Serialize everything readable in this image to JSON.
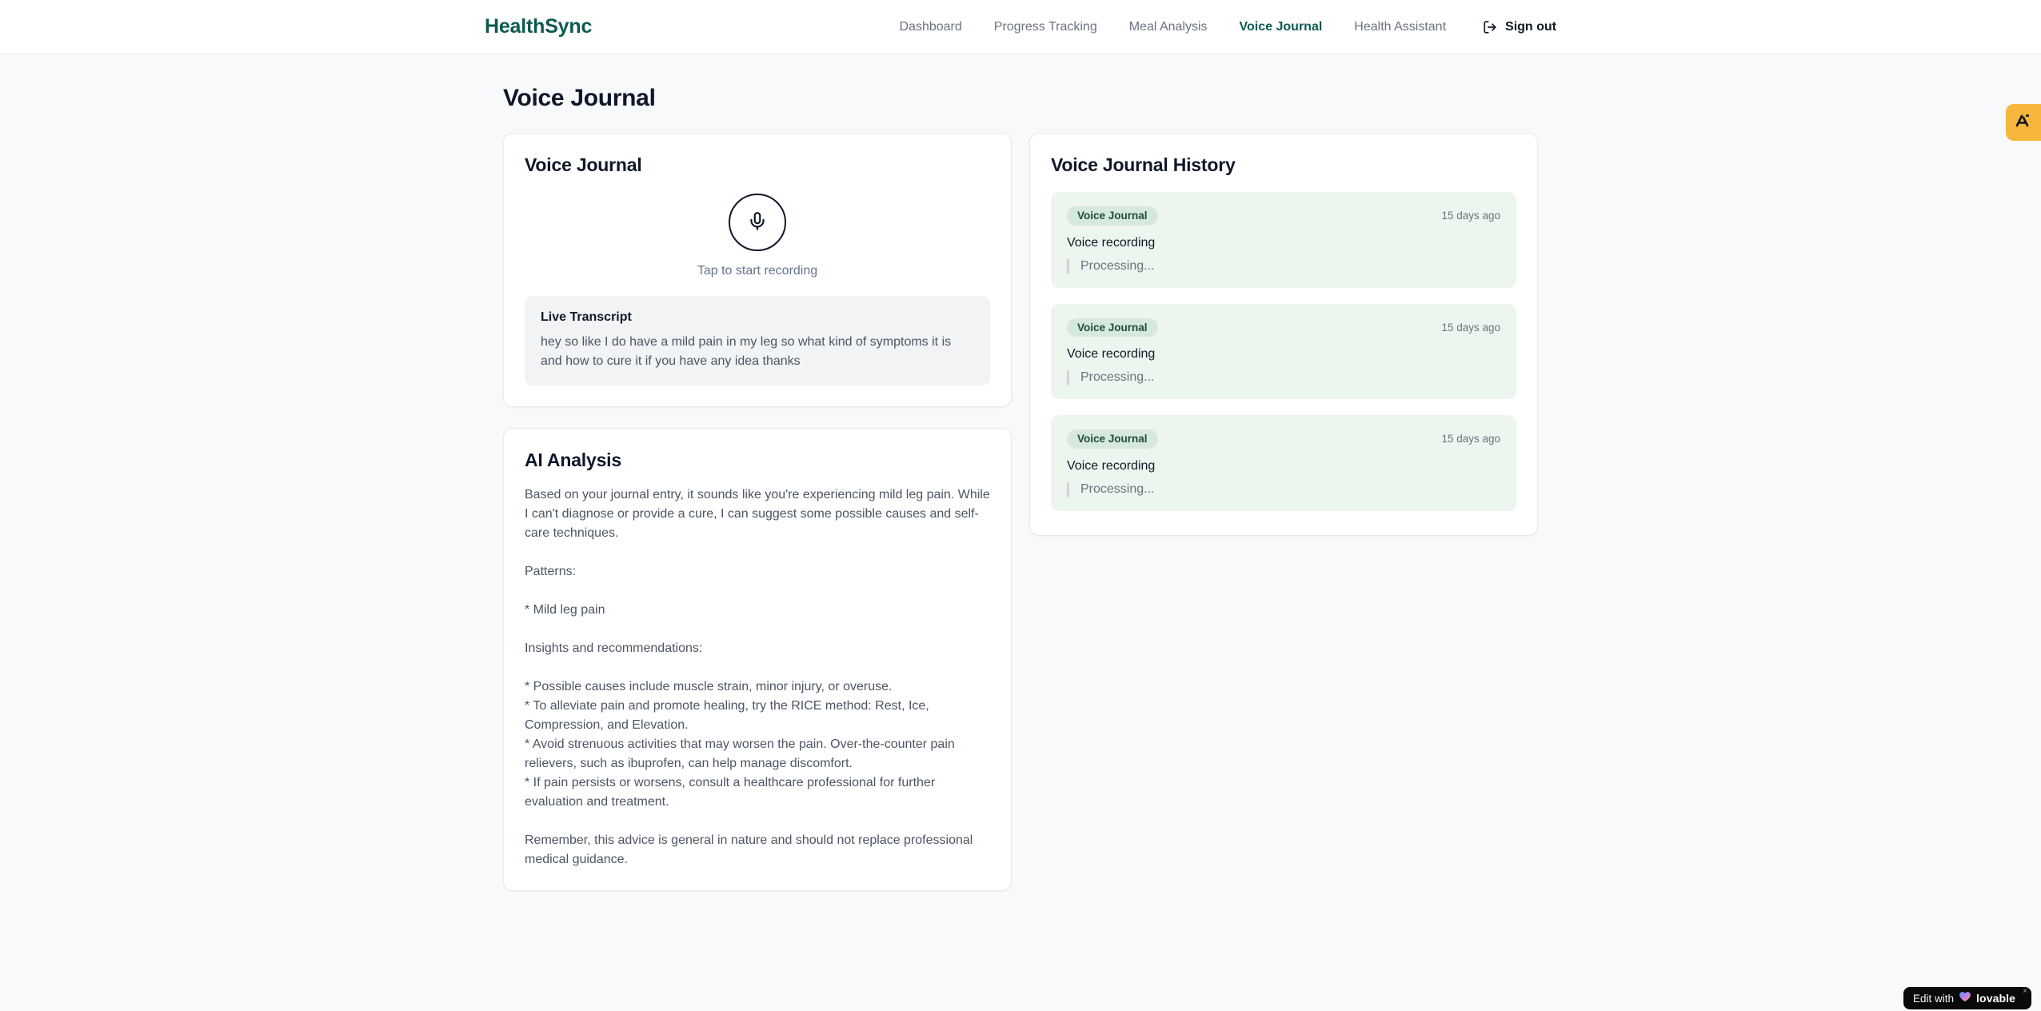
{
  "brand": {
    "name": "HealthSync",
    "color": "#0e5950"
  },
  "nav": {
    "items": [
      {
        "label": "Dashboard",
        "active": false
      },
      {
        "label": "Progress Tracking",
        "active": false
      },
      {
        "label": "Meal Analysis",
        "active": false
      },
      {
        "label": "Voice Journal",
        "active": true
      },
      {
        "label": "Health Assistant",
        "active": false
      }
    ],
    "signout_label": "Sign out"
  },
  "page": {
    "title": "Voice Journal"
  },
  "recorder": {
    "card_title": "Voice Journal",
    "tap_hint": "Tap to start recording",
    "live_transcript": {
      "title": "Live Transcript",
      "text": "hey so like I do have a mild pain in my leg so what kind of symptoms it is and how to cure it if you have any idea thanks"
    }
  },
  "analysis": {
    "card_title": "AI Analysis",
    "text": "Based on your journal entry, it sounds like you're experiencing mild leg pain. While I can't diagnose or provide a cure, I can suggest some possible causes and self-care techniques.\n\nPatterns:\n\n* Mild leg pain\n\nInsights and recommendations:\n\n* Possible causes include muscle strain, minor injury, or overuse.\n* To alleviate pain and promote healing, try the RICE method: Rest, Ice, Compression, and Elevation.\n* Avoid strenuous activities that may worsen the pain. Over-the-counter pain relievers, such as ibuprofen, can help manage discomfort.\n* If pain persists or worsens, consult a healthcare professional for further evaluation and treatment.\n\nRemember, this advice is general in nature and should not replace professional medical guidance."
  },
  "history": {
    "card_title": "Voice Journal History",
    "entries": [
      {
        "badge": "Voice Journal",
        "time": "15 days ago",
        "title": "Voice recording",
        "status": "Processing..."
      },
      {
        "badge": "Voice Journal",
        "time": "15 days ago",
        "title": "Voice recording",
        "status": "Processing..."
      },
      {
        "badge": "Voice Journal",
        "time": "15 days ago",
        "title": "Voice recording",
        "status": "Processing..."
      }
    ],
    "entry_bg": "#ecf5ee",
    "badge_bg": "#d7e9dc",
    "badge_text_color": "#1b4d3e"
  },
  "overlays": {
    "side_badge_color": "#f6b73c",
    "edit_badge": {
      "prefix": "Edit with",
      "brand": "lovable",
      "close": "×"
    }
  }
}
